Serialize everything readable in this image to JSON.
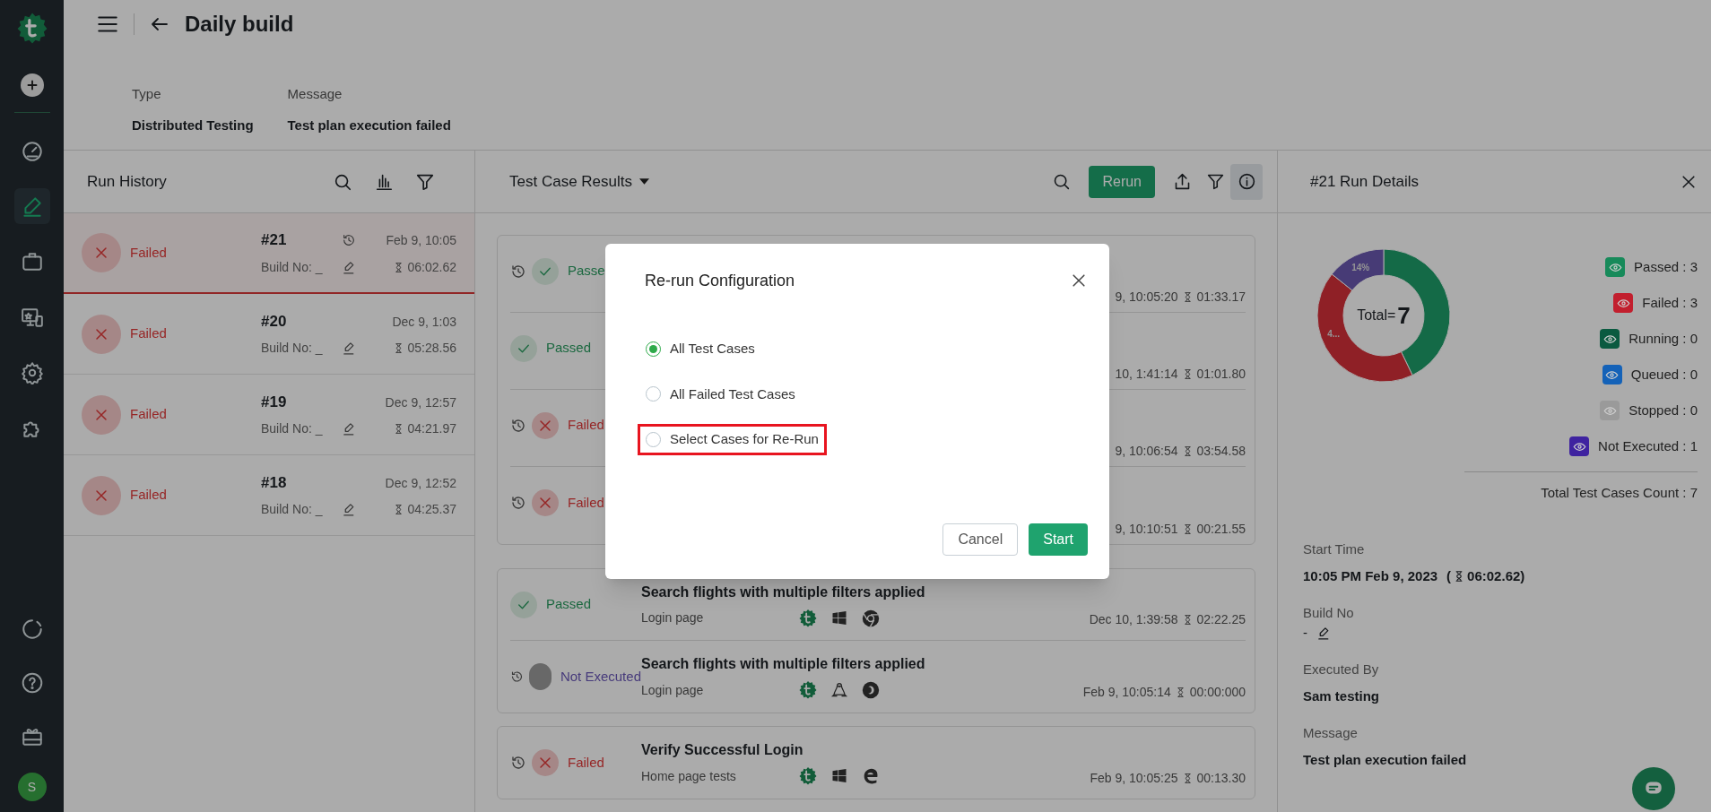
{
  "sidebar": {
    "items": [
      {
        "kind": "gauge",
        "selected": false
      },
      {
        "kind": "pencil",
        "selected": true
      },
      {
        "kind": "briefcase",
        "selected": false
      },
      {
        "kind": "monitor",
        "selected": false
      },
      {
        "kind": "gear",
        "selected": false
      },
      {
        "kind": "puzzle",
        "selected": false
      }
    ],
    "bottom_items": [
      {
        "kind": "loader"
      },
      {
        "kind": "help"
      },
      {
        "kind": "gift"
      }
    ],
    "avatar": "S"
  },
  "header": {
    "title": "Daily build",
    "fields": [
      {
        "label": "Type",
        "value": "Distributed Testing"
      },
      {
        "label": "Message",
        "value": "Test plan execution failed"
      }
    ]
  },
  "run_history": {
    "title": "Run History",
    "rows": [
      {
        "status": "Failed",
        "kind": "failed",
        "number": "#21",
        "rerun": true,
        "date": "Feb 9, 10:05",
        "build": "Build No: _",
        "duration": "06:02.62",
        "selected": true
      },
      {
        "status": "Failed",
        "kind": "failed",
        "number": "#20",
        "rerun": false,
        "date": "Dec 9, 1:03",
        "build": "Build No: _",
        "duration": "05:28.56",
        "selected": false
      },
      {
        "status": "Failed",
        "kind": "failed",
        "number": "#19",
        "rerun": false,
        "date": "Dec 9, 12:57",
        "build": "Build No: _",
        "duration": "04:21.97",
        "selected": false
      },
      {
        "status": "Failed",
        "kind": "failed",
        "number": "#18",
        "rerun": false,
        "date": "Dec 9, 12:52",
        "build": "Build No: _",
        "duration": "04:25.37",
        "selected": false
      }
    ]
  },
  "results": {
    "title": "Test Case Results",
    "rerun_button": "Rerun",
    "groups": [
      [
        {
          "kind": "passed",
          "status": "Passe",
          "rerun": true,
          "date": "9, 10:05:20",
          "duration": "01:33.17"
        },
        {
          "kind": "passed",
          "status": "Passed",
          "rerun": false,
          "date": "10, 1:41:14",
          "duration": "01:01.80"
        },
        {
          "kind": "failed",
          "status": "Failed",
          "rerun": true,
          "date": "9, 10:06:54",
          "duration": "03:54.58"
        },
        {
          "kind": "failed",
          "status": "Failed",
          "rerun": true,
          "date": "9, 10:10:51",
          "duration": "00:21.55"
        }
      ],
      [
        {
          "kind": "passed",
          "status": "Passed",
          "rerun": false,
          "title": "Search flights with multiple filters applied",
          "suite": "Login page",
          "date": "Dec 10, 1:39:58",
          "duration": "02:22.25"
        },
        {
          "kind": "not_executed",
          "status": "Not Executed",
          "rerun": true,
          "title": "Search flights with multiple filters applied",
          "suite": "Login page",
          "date": "Feb 9, 10:05:14",
          "duration": "00:00:000"
        }
      ],
      [
        {
          "kind": "failed",
          "status": "Failed",
          "rerun": true,
          "title": "Verify Successful Login",
          "suite": "Home page tests",
          "date": "Feb 9, 10:05:25",
          "duration": "00:13.30"
        }
      ]
    ]
  },
  "run_details": {
    "title": "#21 Run Details",
    "chart_data": {
      "type": "donut",
      "values": [
        42.86,
        42.86,
        14.28
      ],
      "colors": [
        "#1f9e6a",
        "#d6313a",
        "#6a58b0"
      ],
      "value_labels": [
        null,
        "4...",
        "14%"
      ]
    },
    "total_label": "Total=",
    "total_value": "7",
    "legend": [
      {
        "label": "Passed : 3",
        "color": "#178a5a"
      },
      {
        "label": "Failed : 3",
        "color": "#c21f2e"
      },
      {
        "label": "Running : 0",
        "color": "#0a5a40"
      },
      {
        "label": "Queued : 0",
        "color": "#1462b8"
      },
      {
        "label": "Stopped : 0",
        "color": "#9a9a9a"
      },
      {
        "label": "Not Executed : 1",
        "color": "#3f23a0"
      }
    ],
    "total_count": "Total Test Cases Count : 7",
    "start_label": "Start Time",
    "start_value": "10:05 PM Feb 9, 2023",
    "paren_open": "(",
    "duration": "06:02.62",
    "paren_close": ")",
    "build_label": "Build No",
    "build_value": "-",
    "executed_label": "Executed By",
    "executed_value": "Sam testing",
    "message_label": "Message",
    "message_value": "Test plan execution failed"
  },
  "modal": {
    "title": "Re-run Configuration",
    "options": [
      {
        "label": "All Test Cases",
        "selected": true,
        "highlighted": false
      },
      {
        "label": "All Failed Test Cases",
        "selected": false,
        "highlighted": false
      },
      {
        "label": "Select Cases for Re-Run",
        "selected": false,
        "highlighted": true
      }
    ],
    "buttons": [
      {
        "label": "Cancel",
        "kind": "secondary"
      },
      {
        "label": "Start",
        "kind": "primary"
      }
    ]
  }
}
